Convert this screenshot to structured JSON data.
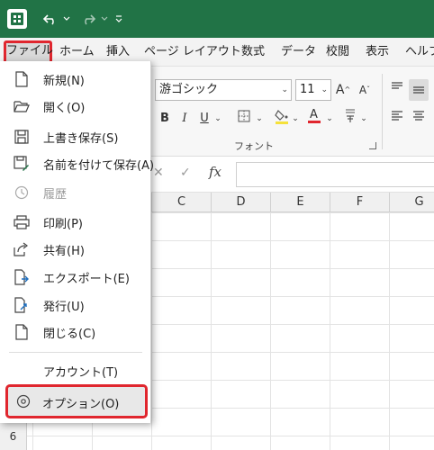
{
  "colors": {
    "title_bar": "#217346",
    "highlight": "#e0262e"
  },
  "tabs": [
    "ファイル",
    "ホーム",
    "挿入",
    "ページ レイアウト",
    "数式",
    "データ",
    "校閲",
    "表示",
    "ヘルプ"
  ],
  "ribbon": {
    "font_name": "游ゴシック",
    "font_size": "11",
    "grow_font": "A",
    "shrink_font": "A",
    "bold": "B",
    "italic": "I",
    "underline": "U",
    "group_label": "フォント"
  },
  "formula_bar": {
    "fx": "fx"
  },
  "columns": [
    "C",
    "D",
    "E",
    "F",
    "G"
  ],
  "row_header": "6",
  "backstage": {
    "items": [
      {
        "label": "新規(N)",
        "icon": "new-file-icon"
      },
      {
        "label": "開く(O)",
        "icon": "open-folder-icon"
      },
      {
        "label": "上書き保存(S)",
        "icon": "save-icon"
      },
      {
        "label": "名前を付けて保存(A)",
        "icon": "save-as-icon"
      },
      {
        "label": "履歴",
        "icon": "history-icon"
      },
      {
        "label": "印刷(P)",
        "icon": "print-icon"
      },
      {
        "label": "共有(H)",
        "icon": "share-icon"
      },
      {
        "label": "エクスポート(E)",
        "icon": "export-icon"
      },
      {
        "label": "発行(U)",
        "icon": "publish-icon"
      },
      {
        "label": "閉じる(C)",
        "icon": "close-document-icon"
      }
    ],
    "account": "アカウント(T)",
    "options": "オプション(O)"
  }
}
